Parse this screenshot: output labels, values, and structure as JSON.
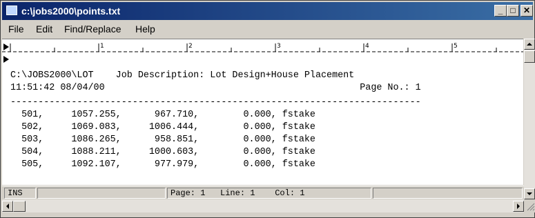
{
  "window": {
    "title": "c:\\jobs2000\\points.txt",
    "minimize_glyph": "_",
    "maximize_glyph": "□",
    "close_glyph": "✕"
  },
  "menu": {
    "items": [
      "File",
      "Edit",
      "Find/Replace",
      "Help"
    ]
  },
  "ruler": {
    "numbers": [
      "1",
      "2",
      "3",
      "4",
      "5"
    ]
  },
  "document": {
    "header_line_1": "C:\\JOBS2000\\LOT    Job Description: Lot Design+House Placement",
    "header_line_2": "11:51:42 08/04/00                                              Page No.: 1",
    "separator": "--------------------------------------------------------------------------",
    "rows": [
      "  501,     1057.255,      967.710,        0.000, fstake",
      "  502,     1069.083,     1006.444,        0.000, fstake",
      "  503,     1086.265,      958.851,        0.000, fstake",
      "  504,     1088.211,     1000.603,        0.000, fstake",
      "  505,     1092.107,      977.979,        0.000, fstake"
    ]
  },
  "status": {
    "mode": "INS",
    "position": "Page: 1   Line: 1    Col: 1"
  },
  "icons": {
    "scroll_up": "up-arrow-icon",
    "scroll_down": "down-arrow-icon",
    "scroll_left": "left-arrow-icon",
    "scroll_right": "right-arrow-icon"
  },
  "colors": {
    "titlebar_start": "#0a246a",
    "titlebar_end": "#3a6ea5",
    "chrome": "#d4d0c8"
  }
}
